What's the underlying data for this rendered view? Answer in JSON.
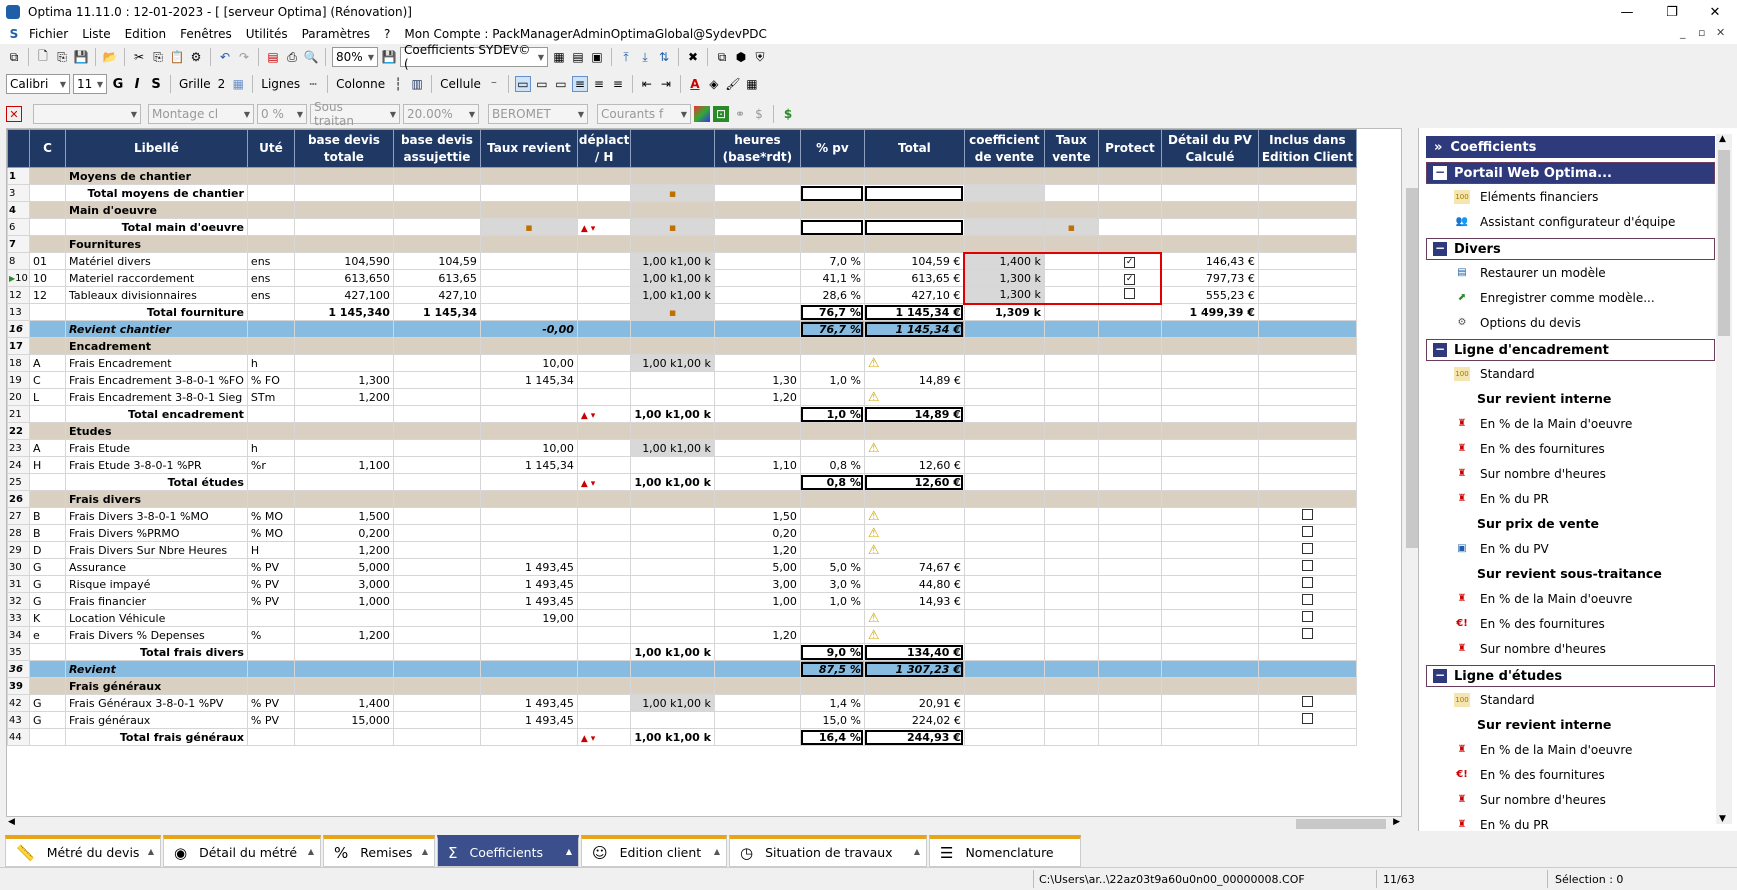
{
  "titlebar": {
    "title": "Optima 11.11.0 : 12-01-2023 - [ [serveur Optima] (Rénovation)]"
  },
  "menu": [
    "Fichier",
    "Liste",
    "Edition",
    "Fenêtres",
    "Utilités",
    "Paramètres",
    "?",
    "Mon Compte : PackManagerAdminOptimaGlobal@SydevPDC"
  ],
  "toolbar1": {
    "zoom": "80%",
    "coef_combo": "Coefficients  SYDEV© ("
  },
  "toolbar2": {
    "font": "Calibri",
    "size": "11",
    "bold": "G",
    "italic": "I",
    "strike": "S",
    "grille": "Grille",
    "grille_val": "2",
    "lignes": "Lignes",
    "colonne": "Colonne",
    "cellule": "Cellule"
  },
  "toolbar3": {
    "montage": "Montage cl",
    "pct": "0 %",
    "sous": "Sous traitan",
    "pct2": "20.00%",
    "berometer": "BEROMET",
    "courants": "Courants f"
  },
  "columns": [
    "",
    "C",
    "Libellé",
    "Uté",
    "base devis totale",
    "base devis assujettie",
    "Taux revient",
    "déplact / H",
    "",
    "heures (base*rdt)",
    "% pv",
    "Total",
    "coefficient de vente",
    "Taux vente",
    "Protect",
    "Détail du PV Calculé",
    "Inclus dans Edition Client"
  ],
  "rows": [
    {
      "n": "1",
      "type": "sec",
      "lib": "Moyens de chantier"
    },
    {
      "n": "3",
      "type": "tot",
      "lib": "Total moyens de chantier"
    },
    {
      "n": "4",
      "type": "sec",
      "lib": "Main d'oeuvre"
    },
    {
      "n": "6",
      "type": "tot",
      "lib": "Total main d'oeuvre"
    },
    {
      "n": "7",
      "type": "sec",
      "lib": "Fournitures"
    },
    {
      "n": "8",
      "c": "01",
      "lib": " Matériel divers",
      "ute": "ens",
      "bt": "104,590",
      "ba": "104,59",
      "h": "1,00 k",
      "pv": "7,0 %",
      "tot": "104,59 €",
      "coef": "1,400 k",
      "prot": "✓",
      "det": "146,43 €"
    },
    {
      "n": "10",
      "c": "10",
      "lib": " Materiel raccordement",
      "ute": "ens",
      "bt": "613,650",
      "ba": "613,65",
      "h": "1,00 k",
      "pv": "41,1 %",
      "tot": "613,65 €",
      "coef": "1,300 k",
      "prot": "✓",
      "det": "797,73 €"
    },
    {
      "n": "12",
      "c": "12",
      "lib": "Tableaux divisionnaires",
      "ute": "ens",
      "bt": "427,100",
      "ba": "427,10",
      "h": "1,00 k",
      "pv": "28,6 %",
      "tot": "427,10 €",
      "coef": "1,300 k",
      "prot": "",
      "det": "555,23 €"
    },
    {
      "n": "13",
      "type": "tot",
      "lib": "Total fourniture",
      "bt": "1 145,340",
      "ba": "1 145,34",
      "pv": "76,7 %",
      "tot": "1 145,34 €",
      "coef": "1,309 k",
      "det": "1 499,39 €"
    },
    {
      "n": "16",
      "type": "blue",
      "lib": "Revient chantier",
      "tr": "-0,00",
      "pv": "76,7 %",
      "tot": "1 145,34 €"
    },
    {
      "n": "17",
      "type": "sec",
      "lib": "Encadrement"
    },
    {
      "n": "18",
      "c": "A",
      "lib": "Frais Encadrement",
      "ute": "h",
      "tr": "10,00",
      "h": "1,00 k",
      "warn": true
    },
    {
      "n": "19",
      "c": "C",
      "lib": "Frais Encadrement 3-8-0-1 %FO",
      "ute": "% FO",
      "bt": "1,300",
      "tr": "1 145,34",
      "hrs": "1,30",
      "pv": "1,0 %",
      "tot": "14,89 €"
    },
    {
      "n": "20",
      "c": "L",
      "lib": "Frais Encadrement 3-8-0-1 Sieg",
      "ute": "STm",
      "bt": "1,200",
      "hrs": "1,20",
      "warn": true
    },
    {
      "n": "21",
      "type": "stot",
      "lib": "Total encadrement",
      "h": "1,00 k",
      "pv": "1,0 %",
      "tot": "14,89 €"
    },
    {
      "n": "22",
      "type": "sec",
      "lib": "Etudes"
    },
    {
      "n": "23",
      "c": "A",
      "lib": "Frais Etude",
      "ute": "h",
      "tr": "10,00",
      "h": "1,00 k",
      "warn": true
    },
    {
      "n": "24",
      "c": "H",
      "lib": "Frais Etude 3-8-0-1 %PR",
      "ute": "%r",
      "bt": "1,100",
      "tr": "1 145,34",
      "hrs": "1,10",
      "pv": "0,8 %",
      "tot": "12,60 €"
    },
    {
      "n": "25",
      "type": "stot",
      "lib": "Total études",
      "h": "1,00 k",
      "pv": "0,8 %",
      "tot": "12,60 €"
    },
    {
      "n": "26",
      "type": "sec",
      "lib": "Frais divers"
    },
    {
      "n": "27",
      "c": "B",
      "lib": "Frais Divers 3-8-0-1 %MO",
      "ute": "% MO",
      "bt": "1,500",
      "hrs": "1,50",
      "warn": true,
      "inc": true
    },
    {
      "n": "28",
      "c": "B",
      "lib": "Frais Divers %PRMO",
      "ute": "% MO",
      "bt": "0,200",
      "hrs": "0,20",
      "warn": true,
      "inc": true
    },
    {
      "n": "29",
      "c": "D",
      "lib": "Frais Divers Sur Nbre Heures",
      "ute": "H",
      "bt": "1,200",
      "hrs": "1,20",
      "warn": true,
      "inc": true
    },
    {
      "n": "30",
      "c": "G",
      "lib": "Assurance",
      "ute": "% PV",
      "bt": "5,000",
      "tr": "1 493,45",
      "hrs": "5,00",
      "pv": "5,0 %",
      "tot": "74,67 €",
      "inc": true
    },
    {
      "n": "31",
      "c": "G",
      "lib": "Risque impayé",
      "ute": "% PV",
      "bt": "3,000",
      "tr": "1 493,45",
      "hrs": "3,00",
      "pv": "3,0 %",
      "tot": "44,80 €",
      "inc": true
    },
    {
      "n": "32",
      "c": "G",
      "lib": "Frais financier",
      "ute": "% PV",
      "bt": "1,000",
      "tr": "1 493,45",
      "hrs": "1,00",
      "pv": "1,0 %",
      "tot": "14,93 €",
      "inc": true
    },
    {
      "n": "33",
      "c": "K",
      "lib": "Location Véhicule",
      "tr": "19,00",
      "warn": true,
      "inc": true
    },
    {
      "n": "34",
      "c": "e",
      "lib": "Frais Divers % Depenses",
      "ute": "%",
      "bt": "1,200",
      "hrs": "1,20",
      "warn": true,
      "inc": true
    },
    {
      "n": "35",
      "type": "stot2",
      "lib": "Total frais divers",
      "h": "1,00 k",
      "pv": "9,0 %",
      "tot": "134,40 €"
    },
    {
      "n": "36",
      "type": "blue",
      "lib": "Revient",
      "pv": "87,5 %",
      "tot": "1 307,23 €"
    },
    {
      "n": "39",
      "type": "sec",
      "lib": "Frais généraux"
    },
    {
      "n": "42",
      "c": "G",
      "lib": "Frais Généraux 3-8-0-1 %PV",
      "ute": "% PV",
      "bt": "1,400",
      "tr": "1 493,45",
      "h": "1,00 k",
      "pv": "1,4 %",
      "tot": "20,91 €",
      "inc": true
    },
    {
      "n": "43",
      "c": "G",
      "lib": "Frais généraux",
      "ute": "% PV",
      "bt": "15,000",
      "tr": "1 493,45",
      "pv": "15,0 %",
      "tot": "224,02 €",
      "inc": true
    },
    {
      "n": "44",
      "type": "stot",
      "lib": "Total frais généraux",
      "h": "1,00 k",
      "pv": "16,4 %",
      "tot": "244,93 €"
    }
  ],
  "rpanel": {
    "coef_header": "Coefficients",
    "portail": "Portail Web Optima...",
    "portail_items": [
      "Eléments financiers",
      "Assistant configurateur d'équipe"
    ],
    "divers": "Divers",
    "divers_items": [
      "Restaurer un modèle",
      "Enregistrer comme modèle...",
      "Options du devis"
    ],
    "encadrement": "Ligne d'encadrement",
    "enc_standard": "Standard",
    "enc_sub1": "Sur revient interne",
    "enc_sub1_items": [
      "En % de la Main d'oeuvre",
      "En % des fournitures",
      "Sur nombre d'heures",
      "En % du PR"
    ],
    "enc_sub2": "Sur prix de vente",
    "enc_sub2_items": [
      "En % du PV"
    ],
    "enc_sub3": "Sur revient sous-traitance",
    "enc_sub3_items": [
      "En % de la Main d'oeuvre",
      "En % des fournitures",
      "Sur nombre d'heures"
    ],
    "etudes": "Ligne d'études",
    "et_standard": "Standard",
    "et_sub1": "Sur revient interne",
    "et_sub1_items": [
      "En % de la Main d'oeuvre",
      "En % des fournitures",
      "Sur nombre d'heures",
      "En % du PR"
    ]
  },
  "tabs": [
    "Métré du devis",
    "Détail du métré",
    "Remises",
    "Coefficients",
    "Edition client",
    "Situation de travaux",
    "Nomenclature"
  ],
  "status": {
    "path": "C:\\Users\\ar..\\22az03t9a60u0n00_00000008.COF",
    "pos": "11/63",
    "sel": "Sélection : 0"
  }
}
